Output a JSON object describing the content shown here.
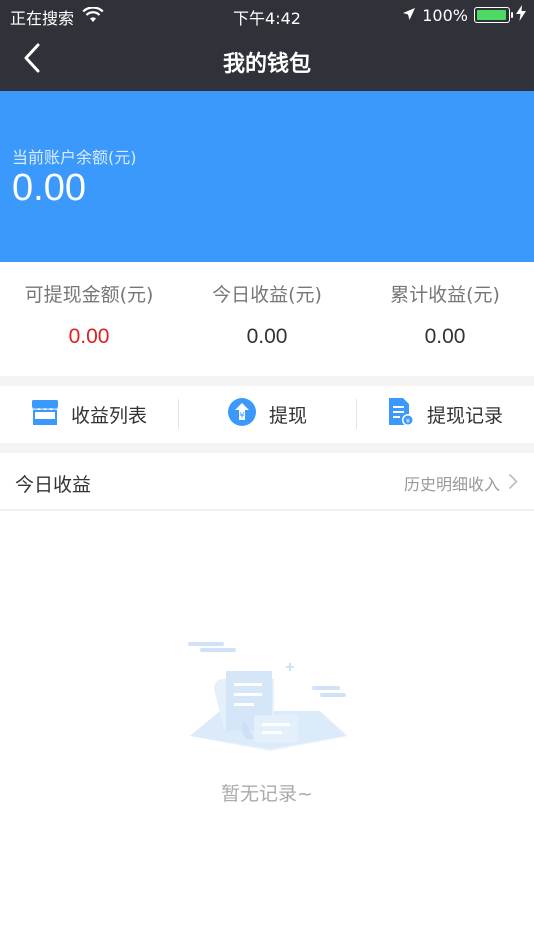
{
  "status_bar": {
    "carrier": "正在搜索",
    "time": "下午4:42",
    "battery": "100%",
    "icons": [
      "wifi-icon",
      "location-icon",
      "battery-icon",
      "charging-icon"
    ]
  },
  "nav": {
    "title": "我的钱包",
    "back_icon": "chevron-left-icon"
  },
  "balance": {
    "label": "当前账户余额(元)",
    "amount": "0.00"
  },
  "stats": [
    {
      "label": "可提现金额(元)",
      "value": "0.00",
      "color": "#e02020"
    },
    {
      "label": "今日收益(元)",
      "value": "0.00",
      "color": "#333333"
    },
    {
      "label": "累计收益(元)",
      "value": "0.00",
      "color": "#333333"
    }
  ],
  "actions": [
    {
      "label": "收益列表",
      "icon": "store-icon"
    },
    {
      "label": "提现",
      "icon": "withdraw-icon"
    },
    {
      "label": "提现记录",
      "icon": "record-icon"
    }
  ],
  "today_section": {
    "title": "今日收益",
    "link": "历史明细收入"
  },
  "empty_state": {
    "text": "暂无记录~",
    "icon": "empty-scroll-illustration"
  },
  "colors": {
    "header_bg": "#2f3239",
    "accent_blue": "#3b99fc",
    "withdrawable_red": "#e02020"
  }
}
